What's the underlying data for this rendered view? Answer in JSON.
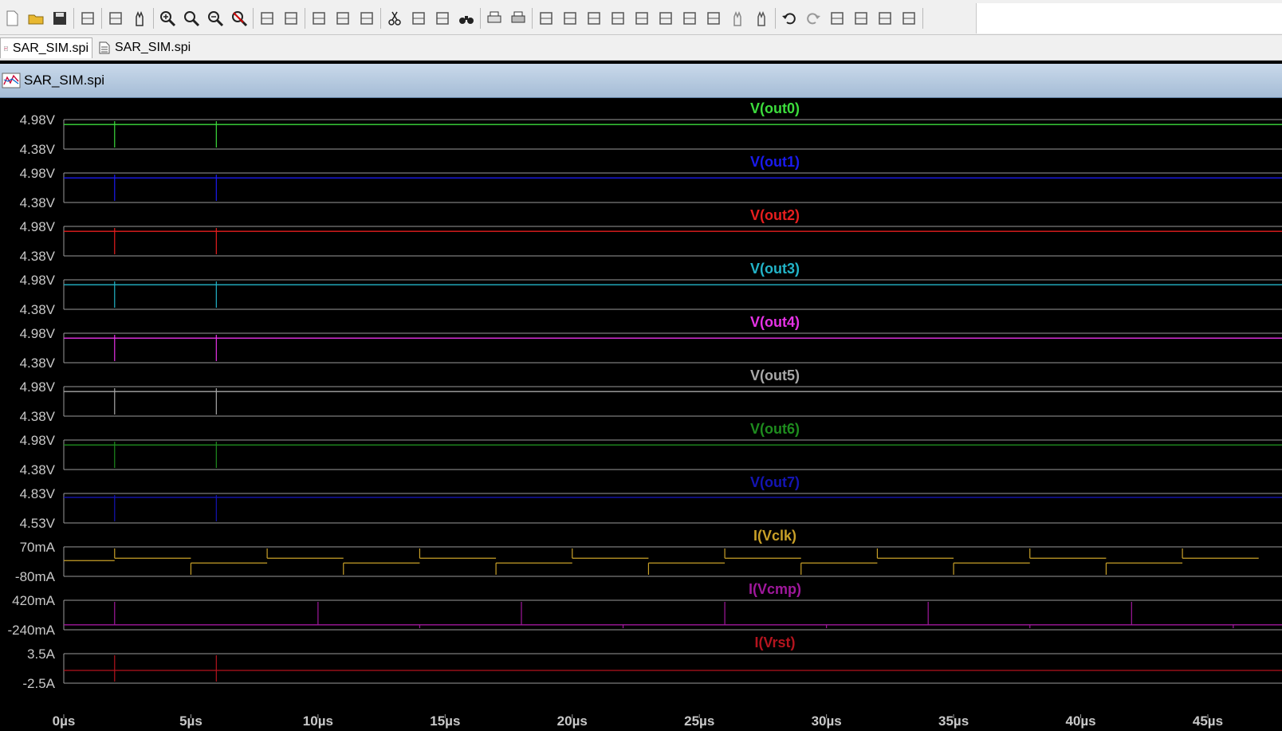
{
  "toolbar": {
    "icons": [
      "new-icon",
      "open-icon",
      "save-icon",
      "control-panel-icon",
      "run-icon",
      "halt-icon",
      "zoom-in-icon",
      "zoom-area-icon",
      "zoom-out-icon",
      "zoom-cancel-icon",
      "autorange-icon",
      "manual-limits-icon",
      "tile-vertical-icon",
      "cascade-icon",
      "tile-horizontal-icon",
      "cut-icon",
      "copy-icon",
      "paste-icon",
      "find-icon",
      "print-icon",
      "print-setup-icon",
      "draw-wire-icon",
      "ground-icon",
      "label-net-icon",
      "resistor-icon",
      "capacitor-icon",
      "inductor-icon",
      "diode-icon",
      "component-icon",
      "move-icon",
      "drag-icon",
      "undo-icon",
      "redo-icon",
      "rotate-icon",
      "mirror-icon",
      "text-icon",
      "spice-directive-icon"
    ]
  },
  "tabs": [
    {
      "label": "SAR_SIM.spi",
      "icon": "waveform-icon",
      "active": true
    },
    {
      "label": "SAR_SIM.spi",
      "icon": "document-icon",
      "active": false
    }
  ],
  "document": {
    "title": "SAR_SIM.spi",
    "icon": "waveform-icon"
  },
  "chart_data": {
    "type": "line",
    "xlabel": "",
    "x_ticks": [
      "0µs",
      "5µs",
      "10µs",
      "15µs",
      "20µs",
      "25µs",
      "30µs",
      "35µs",
      "40µs",
      "45µs"
    ],
    "x_unit": "µs",
    "xlim": [
      0,
      47
    ],
    "panes": [
      {
        "name": "V(out0)",
        "color": "#3cdc3c",
        "ymax_label": "4.98V",
        "ymin_label": "4.38V",
        "ylim": [
          4.38,
          4.98
        ],
        "level": 4.88,
        "spikes_us": [
          2,
          6
        ]
      },
      {
        "name": "V(out1)",
        "color": "#1a1aee",
        "ymax_label": "4.98V",
        "ymin_label": "4.38V",
        "ylim": [
          4.38,
          4.98
        ],
        "level": 4.88,
        "spikes_us": [
          2,
          6
        ]
      },
      {
        "name": "V(out2)",
        "color": "#e61e1e",
        "ymax_label": "4.98V",
        "ymin_label": "4.38V",
        "ylim": [
          4.38,
          4.98
        ],
        "level": 4.88,
        "spikes_us": [
          2,
          6
        ]
      },
      {
        "name": "V(out3)",
        "color": "#22b4c8",
        "ymax_label": "4.98V",
        "ymin_label": "4.38V",
        "ylim": [
          4.38,
          4.98
        ],
        "level": 4.88,
        "spikes_us": [
          2,
          6
        ]
      },
      {
        "name": "V(out4)",
        "color": "#e632e6",
        "ymax_label": "4.98V",
        "ymin_label": "4.38V",
        "ylim": [
          4.38,
          4.98
        ],
        "level": 4.88,
        "spikes_us": [
          2,
          6
        ]
      },
      {
        "name": "V(out5)",
        "color": "#a8a8a8",
        "ymax_label": "4.98V",
        "ymin_label": "4.38V",
        "ylim": [
          4.38,
          4.98
        ],
        "level": 4.88,
        "spikes_us": [
          2,
          6
        ]
      },
      {
        "name": "V(out6)",
        "color": "#1e8c1e",
        "ymax_label": "4.98V",
        "ymin_label": "4.38V",
        "ylim": [
          4.38,
          4.98
        ],
        "level": 4.88,
        "spikes_us": [
          2,
          6
        ]
      },
      {
        "name": "V(out7)",
        "color": "#1414b4",
        "ymax_label": "4.83V",
        "ymin_label": "4.53V",
        "ylim": [
          4.53,
          4.83
        ],
        "level": 4.79,
        "spikes_us": [
          2,
          6
        ]
      },
      {
        "name": "I(Vclk)",
        "color": "#c8a028",
        "ymax_label": "70mA",
        "ymin_label": "-80mA",
        "ylim": [
          -80,
          70
        ],
        "level": 0,
        "clock_period_us": 6,
        "clock_start_us": 2
      },
      {
        "name": "I(Vcmp)",
        "color": "#a0189c",
        "ymax_label": "420mA",
        "ymin_label": "-240mA",
        "ylim": [
          -240,
          420
        ],
        "level": -130,
        "up_spikes_us": [
          2,
          10,
          18,
          26,
          34,
          42
        ],
        "down_spikes_us": [
          14,
          22,
          30,
          38,
          46
        ]
      },
      {
        "name": "I(Vrst)",
        "color": "#b4141e",
        "ymax_label": "3.5A",
        "ymin_label": "-2.5A",
        "ylim": [
          -2.5,
          3.5
        ],
        "level": 0.1,
        "spikes_us": [
          2,
          6
        ]
      }
    ]
  }
}
